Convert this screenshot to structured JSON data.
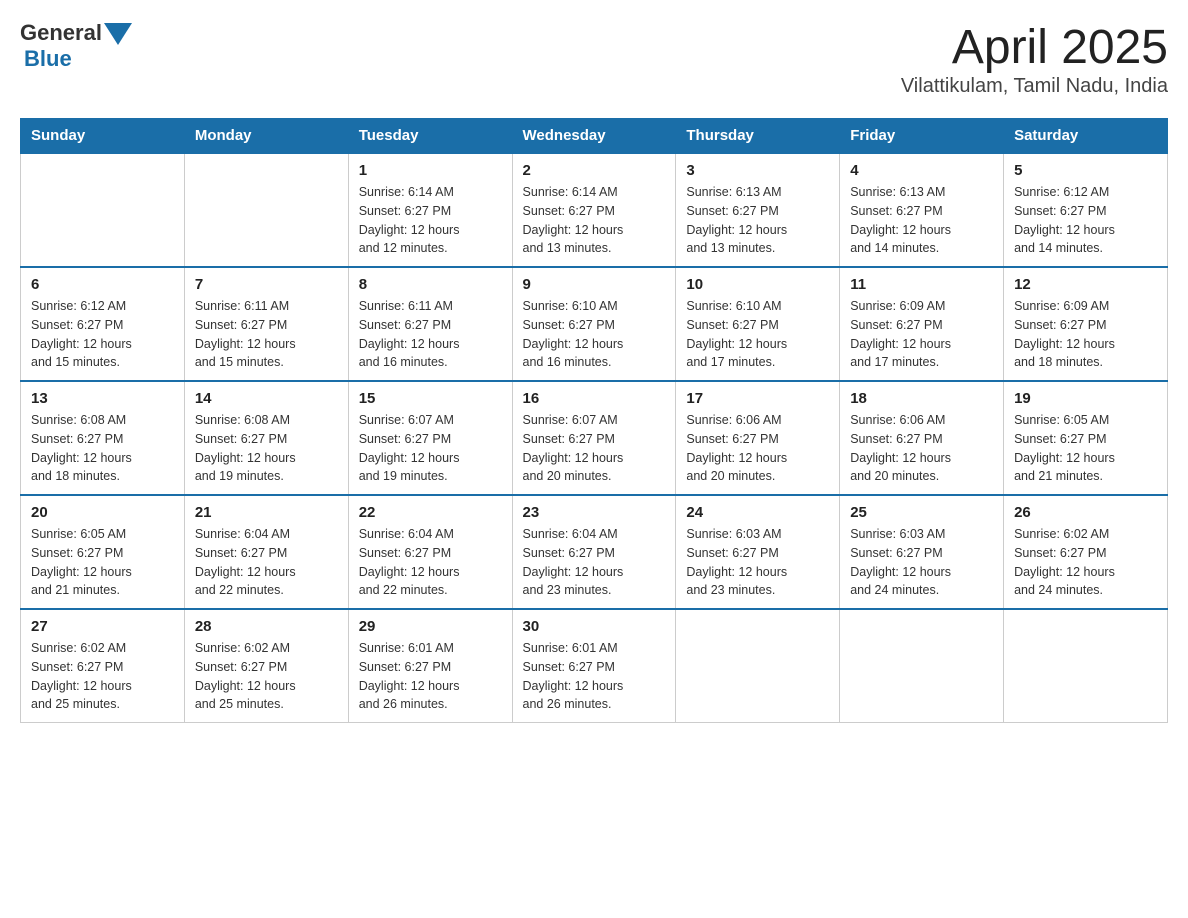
{
  "header": {
    "logo": {
      "general": "General",
      "blue": "Blue"
    },
    "title": "April 2025",
    "subtitle": "Vilattikulam, Tamil Nadu, India"
  },
  "calendar": {
    "days_of_week": [
      "Sunday",
      "Monday",
      "Tuesday",
      "Wednesday",
      "Thursday",
      "Friday",
      "Saturday"
    ],
    "weeks": [
      [
        {
          "day": "",
          "info": ""
        },
        {
          "day": "",
          "info": ""
        },
        {
          "day": "1",
          "info": "Sunrise: 6:14 AM\nSunset: 6:27 PM\nDaylight: 12 hours\nand 12 minutes."
        },
        {
          "day": "2",
          "info": "Sunrise: 6:14 AM\nSunset: 6:27 PM\nDaylight: 12 hours\nand 13 minutes."
        },
        {
          "day": "3",
          "info": "Sunrise: 6:13 AM\nSunset: 6:27 PM\nDaylight: 12 hours\nand 13 minutes."
        },
        {
          "day": "4",
          "info": "Sunrise: 6:13 AM\nSunset: 6:27 PM\nDaylight: 12 hours\nand 14 minutes."
        },
        {
          "day": "5",
          "info": "Sunrise: 6:12 AM\nSunset: 6:27 PM\nDaylight: 12 hours\nand 14 minutes."
        }
      ],
      [
        {
          "day": "6",
          "info": "Sunrise: 6:12 AM\nSunset: 6:27 PM\nDaylight: 12 hours\nand 15 minutes."
        },
        {
          "day": "7",
          "info": "Sunrise: 6:11 AM\nSunset: 6:27 PM\nDaylight: 12 hours\nand 15 minutes."
        },
        {
          "day": "8",
          "info": "Sunrise: 6:11 AM\nSunset: 6:27 PM\nDaylight: 12 hours\nand 16 minutes."
        },
        {
          "day": "9",
          "info": "Sunrise: 6:10 AM\nSunset: 6:27 PM\nDaylight: 12 hours\nand 16 minutes."
        },
        {
          "day": "10",
          "info": "Sunrise: 6:10 AM\nSunset: 6:27 PM\nDaylight: 12 hours\nand 17 minutes."
        },
        {
          "day": "11",
          "info": "Sunrise: 6:09 AM\nSunset: 6:27 PM\nDaylight: 12 hours\nand 17 minutes."
        },
        {
          "day": "12",
          "info": "Sunrise: 6:09 AM\nSunset: 6:27 PM\nDaylight: 12 hours\nand 18 minutes."
        }
      ],
      [
        {
          "day": "13",
          "info": "Sunrise: 6:08 AM\nSunset: 6:27 PM\nDaylight: 12 hours\nand 18 minutes."
        },
        {
          "day": "14",
          "info": "Sunrise: 6:08 AM\nSunset: 6:27 PM\nDaylight: 12 hours\nand 19 minutes."
        },
        {
          "day": "15",
          "info": "Sunrise: 6:07 AM\nSunset: 6:27 PM\nDaylight: 12 hours\nand 19 minutes."
        },
        {
          "day": "16",
          "info": "Sunrise: 6:07 AM\nSunset: 6:27 PM\nDaylight: 12 hours\nand 20 minutes."
        },
        {
          "day": "17",
          "info": "Sunrise: 6:06 AM\nSunset: 6:27 PM\nDaylight: 12 hours\nand 20 minutes."
        },
        {
          "day": "18",
          "info": "Sunrise: 6:06 AM\nSunset: 6:27 PM\nDaylight: 12 hours\nand 20 minutes."
        },
        {
          "day": "19",
          "info": "Sunrise: 6:05 AM\nSunset: 6:27 PM\nDaylight: 12 hours\nand 21 minutes."
        }
      ],
      [
        {
          "day": "20",
          "info": "Sunrise: 6:05 AM\nSunset: 6:27 PM\nDaylight: 12 hours\nand 21 minutes."
        },
        {
          "day": "21",
          "info": "Sunrise: 6:04 AM\nSunset: 6:27 PM\nDaylight: 12 hours\nand 22 minutes."
        },
        {
          "day": "22",
          "info": "Sunrise: 6:04 AM\nSunset: 6:27 PM\nDaylight: 12 hours\nand 22 minutes."
        },
        {
          "day": "23",
          "info": "Sunrise: 6:04 AM\nSunset: 6:27 PM\nDaylight: 12 hours\nand 23 minutes."
        },
        {
          "day": "24",
          "info": "Sunrise: 6:03 AM\nSunset: 6:27 PM\nDaylight: 12 hours\nand 23 minutes."
        },
        {
          "day": "25",
          "info": "Sunrise: 6:03 AM\nSunset: 6:27 PM\nDaylight: 12 hours\nand 24 minutes."
        },
        {
          "day": "26",
          "info": "Sunrise: 6:02 AM\nSunset: 6:27 PM\nDaylight: 12 hours\nand 24 minutes."
        }
      ],
      [
        {
          "day": "27",
          "info": "Sunrise: 6:02 AM\nSunset: 6:27 PM\nDaylight: 12 hours\nand 25 minutes."
        },
        {
          "day": "28",
          "info": "Sunrise: 6:02 AM\nSunset: 6:27 PM\nDaylight: 12 hours\nand 25 minutes."
        },
        {
          "day": "29",
          "info": "Sunrise: 6:01 AM\nSunset: 6:27 PM\nDaylight: 12 hours\nand 26 minutes."
        },
        {
          "day": "30",
          "info": "Sunrise: 6:01 AM\nSunset: 6:27 PM\nDaylight: 12 hours\nand 26 minutes."
        },
        {
          "day": "",
          "info": ""
        },
        {
          "day": "",
          "info": ""
        },
        {
          "day": "",
          "info": ""
        }
      ]
    ]
  }
}
